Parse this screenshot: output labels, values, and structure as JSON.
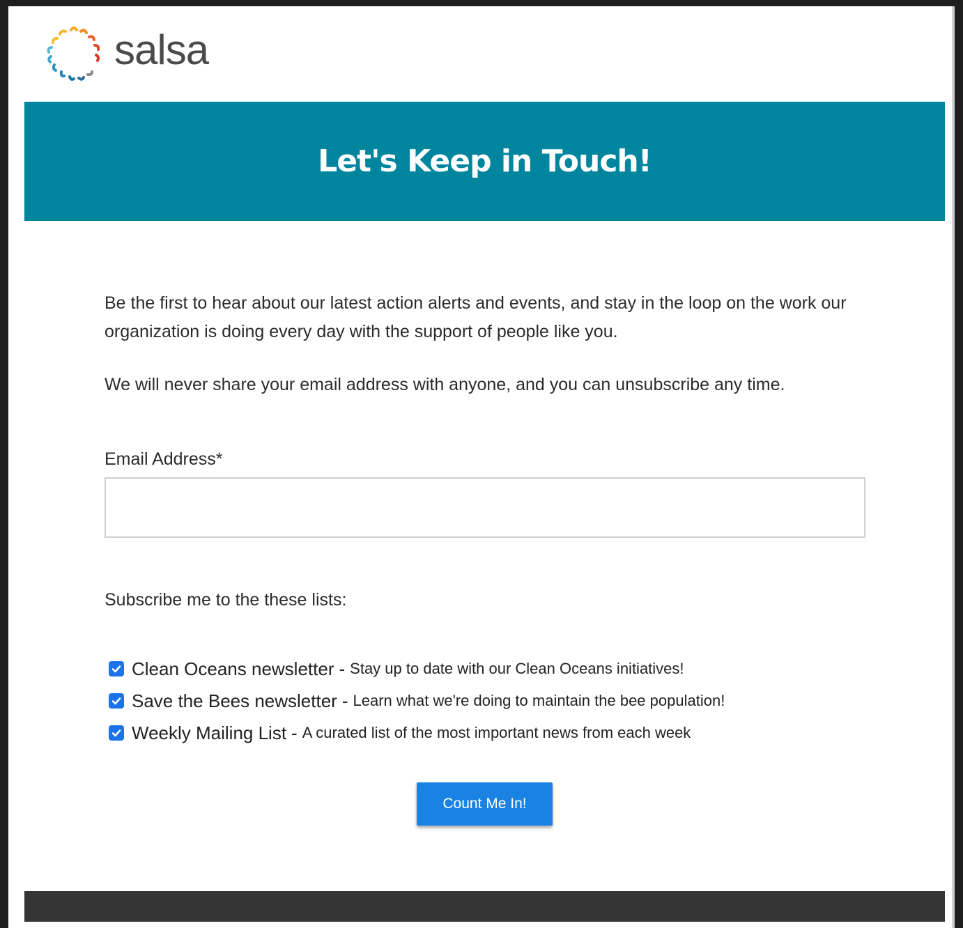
{
  "brand": {
    "name": "salsa",
    "logo_icon": "salsa-sunburst-logo",
    "colors": {
      "banner": "#00859f",
      "button": "#1a82e2",
      "footer": "#353535",
      "checkbox": "#1a73e8"
    }
  },
  "header": {
    "title": "Let's Keep in Touch!"
  },
  "intro": {
    "paragraph1": "Be the first to hear about our latest action alerts and events, and stay in the loop on the work our organization is doing every day with the support of people like you.",
    "paragraph2": "We will never share your email address with anyone, and you can unsubscribe any time."
  },
  "form": {
    "email_label": "Email Address*",
    "email_value": "",
    "lists_label": "Subscribe me to the these lists:",
    "lists": [
      {
        "name": "Clean Oceans newsletter",
        "separator": "-",
        "description": "Stay up to date with our Clean Oceans initiatives!",
        "checked": true
      },
      {
        "name": "Save the Bees newsletter",
        "separator": "-",
        "description": "Learn what we're doing to maintain the bee population!",
        "checked": true
      },
      {
        "name": "Weekly Mailing List",
        "separator": "-",
        "description": "A curated list of the most important news from each week",
        "checked": true
      }
    ],
    "submit_label": "Count Me In!"
  }
}
